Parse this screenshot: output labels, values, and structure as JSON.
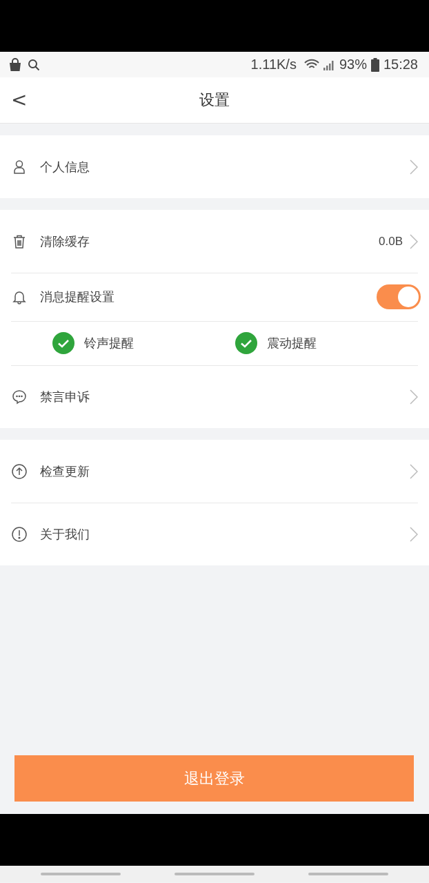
{
  "status_bar": {
    "net_speed": "1.11K/s",
    "battery": "93%",
    "time": "15:28"
  },
  "header": {
    "back": "<",
    "title": "设置"
  },
  "groups": [
    {
      "rows": [
        {
          "kind": "link",
          "label": "个人信息"
        }
      ]
    },
    {
      "rows": [
        {
          "kind": "link",
          "label": "清除缓存",
          "value": "0.0B"
        },
        {
          "kind": "toggle",
          "label": "消息提醒设置",
          "on": true
        },
        {
          "kind": "checks",
          "options": [
            {
              "label": "铃声提醒",
              "checked": true
            },
            {
              "label": "震动提醒",
              "checked": true
            }
          ]
        },
        {
          "kind": "link",
          "label": "禁言申诉"
        }
      ]
    },
    {
      "rows": [
        {
          "kind": "link",
          "label": "检查更新"
        },
        {
          "kind": "link",
          "label": "关于我们"
        }
      ]
    }
  ],
  "logout_button": "退出登录"
}
